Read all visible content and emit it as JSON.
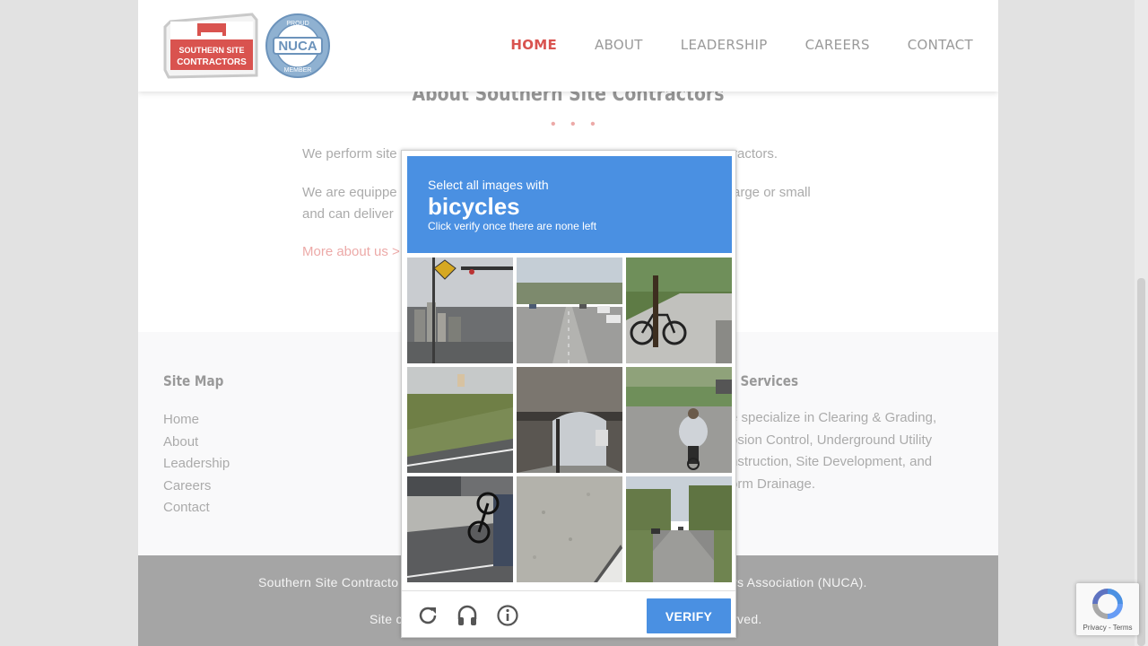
{
  "colors": {
    "accent": "#d9534f",
    "captcha_blue": "#4a90e2",
    "footer_dark": "#4a4a4a"
  },
  "header": {
    "logo_line1": "SOUTHERN SITE",
    "logo_line2": "CONTRACTORS",
    "nuca_badge_top": "PROUD",
    "nuca_badge_mid": "NUCA",
    "nuca_badge_bottom": "MEMBER",
    "nav": [
      {
        "label": "HOME",
        "active": true
      },
      {
        "label": "ABOUT"
      },
      {
        "label": "LEADERSHIP"
      },
      {
        "label": "CAREERS"
      },
      {
        "label": "CONTACT"
      }
    ]
  },
  "about": {
    "title": "About Southern Site Contractors",
    "dots": "• • •",
    "p1_start": "We perform site",
    "p1_end": "ractors.",
    "p2_start_l1": "We are equippe",
    "p2_start_l2": "and can deliver",
    "p2_end": "arge or small",
    "more_link": "More about us >"
  },
  "footer": {
    "sitemap_heading": "Site Map",
    "sitemap_items": [
      "Home",
      "About",
      "Leadership",
      "Careers",
      "Contact"
    ],
    "services_heading": "r Services",
    "services_lines": [
      "e specialize in Clearing & Grading,",
      "osion Control, Underground Utility",
      "nstruction, Site Development, and",
      "orm Drainage."
    ],
    "bottom_l1_left": "Southern Site Contracto",
    "bottom_l1_right": "rs Association (NUCA).",
    "bottom_l2_left": "Site c",
    "bottom_l2_right": "rved."
  },
  "captcha": {
    "instruction": "Select all images with",
    "target": "bicycles",
    "hint": "Click verify once there are none left",
    "tiles": [
      {
        "icon": "road-sign-image"
      },
      {
        "icon": "highway-traffic-image"
      },
      {
        "icon": "parked-bicycle-image"
      },
      {
        "icon": "grass-roadside-image"
      },
      {
        "icon": "bridge-underpass-image"
      },
      {
        "icon": "cyclist-rider-image"
      },
      {
        "icon": "bicycle-on-car-image"
      },
      {
        "icon": "pavement-closeup-image"
      },
      {
        "icon": "tree-lined-street-image"
      }
    ],
    "reload_icon": "reload-icon",
    "audio_icon": "headphones-icon",
    "info_icon": "info-icon",
    "verify_label": "VERIFY"
  },
  "recaptcha_badge": {
    "text": "Privacy - Terms"
  }
}
